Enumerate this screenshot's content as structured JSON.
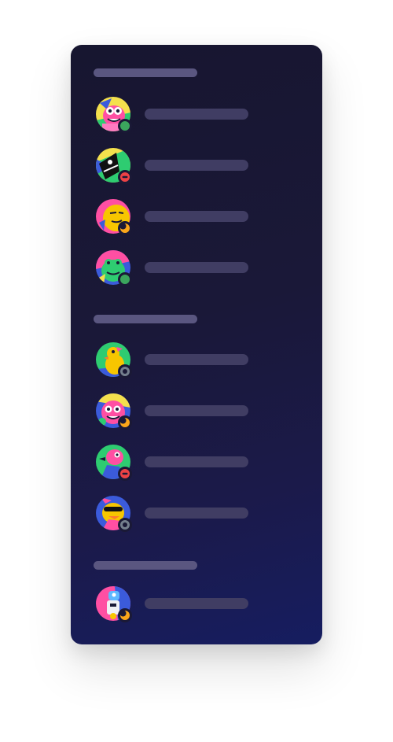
{
  "panel": {
    "sections": [
      {
        "members": [
          {
            "avatar": "pink-creature-avatar",
            "status": "online",
            "status_icon": "online-status-icon"
          },
          {
            "avatar": "black-creature-avatar",
            "status": "dnd",
            "status_icon": "dnd-status-icon"
          },
          {
            "avatar": "yellow-smirk-avatar",
            "status": "idle",
            "status_icon": "idle-moon-icon"
          },
          {
            "avatar": "green-frog-avatar",
            "status": "online",
            "status_icon": "online-status-icon"
          }
        ]
      },
      {
        "members": [
          {
            "avatar": "yellow-duck-avatar",
            "status": "offline",
            "status_icon": "offline-status-icon"
          },
          {
            "avatar": "pink-blob-avatar",
            "status": "idle",
            "status_icon": "idle-moon-icon"
          },
          {
            "avatar": "pink-bird-avatar",
            "status": "dnd",
            "status_icon": "dnd-status-icon"
          },
          {
            "avatar": "sunglasses-duck-avatar",
            "status": "offline",
            "status_icon": "offline-status-icon"
          }
        ]
      },
      {
        "members": [
          {
            "avatar": "blue-robot-avatar",
            "status": "idle",
            "status_icon": "idle-moon-icon"
          }
        ]
      }
    ]
  },
  "colors": {
    "online": "#3ba55d",
    "dnd": "#ed4245",
    "idle": "#faa61a",
    "offline": "#747f8d",
    "placeholder_bar": "#403d63",
    "section_bar": "#5a5680"
  }
}
